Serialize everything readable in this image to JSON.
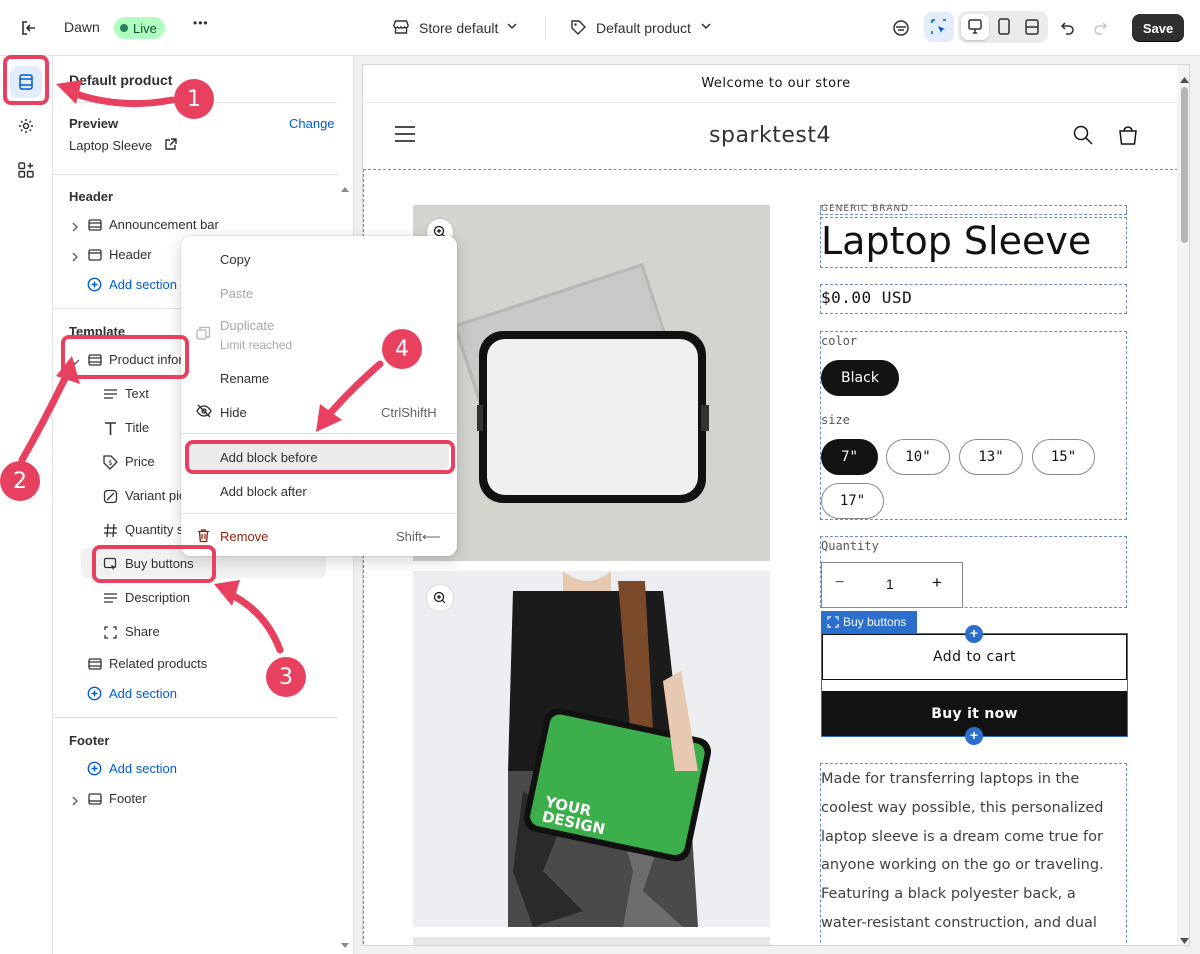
{
  "topbar": {
    "theme_name": "Dawn",
    "live_badge": "Live",
    "more_label": "•••",
    "store_selector": "Store default",
    "template_selector": "Default product",
    "save_label": "Save"
  },
  "sidebar": {
    "title": "Default product",
    "preview_label": "Preview",
    "change_label": "Change",
    "preview_product": "Laptop Sleeve",
    "header_section": "Header",
    "header_items": [
      "Announcement bar",
      "Header"
    ],
    "add_section": "Add section",
    "template_section": "Template",
    "product_info": "Product infor",
    "blocks": [
      "Text",
      "Title",
      "Price",
      "Variant pic",
      "Quantity s",
      "Buy buttons",
      "Description",
      "Share"
    ],
    "related_products": "Related products",
    "footer_section": "Footer",
    "footer_item": "Footer"
  },
  "context_menu": {
    "copy": "Copy",
    "paste": "Paste",
    "duplicate": "Duplicate",
    "limit": "Limit reached",
    "rename": "Rename",
    "hide": "Hide",
    "hide_shortcut": "CtrlShiftH",
    "add_before": "Add block before",
    "add_after": "Add block after",
    "remove": "Remove",
    "remove_shortcut": "Shift⟵"
  },
  "store": {
    "announcement": "Welcome to our store",
    "store_name": "sparktest4",
    "vendor": "GENERIC BRAND",
    "product_title": "Laptop Sleeve",
    "price": "$0.00 USD",
    "color_label": "color",
    "color_value": "Black",
    "size_label": "size",
    "sizes": [
      "7\"",
      "10\"",
      "13\"",
      "15\"",
      "17\""
    ],
    "quantity_label": "Quantity",
    "quantity_value": "1",
    "minus": "−",
    "plus": "+",
    "buy_buttons_tag": "Buy buttons",
    "add_to_cart": "Add to cart",
    "buy_now": "Buy it now",
    "description": "Made for transferring laptops in the coolest way possible, this personalized laptop sleeve is a dream come true for anyone working on the go or traveling. Featuring a black polyester back, a water-resistant construction, and dual zipper enclosures, this personalized laptop",
    "design_text_1": "YOUR",
    "design_text_2": "DESIGN"
  },
  "annotations": [
    "1",
    "2",
    "3",
    "4"
  ],
  "colors": {
    "accent_red": "#e8415f",
    "link_blue": "#005bd3",
    "live_green": "#1a7f37",
    "buy_now_bg": "#121212",
    "sleeve_green": "#3cae4b"
  }
}
